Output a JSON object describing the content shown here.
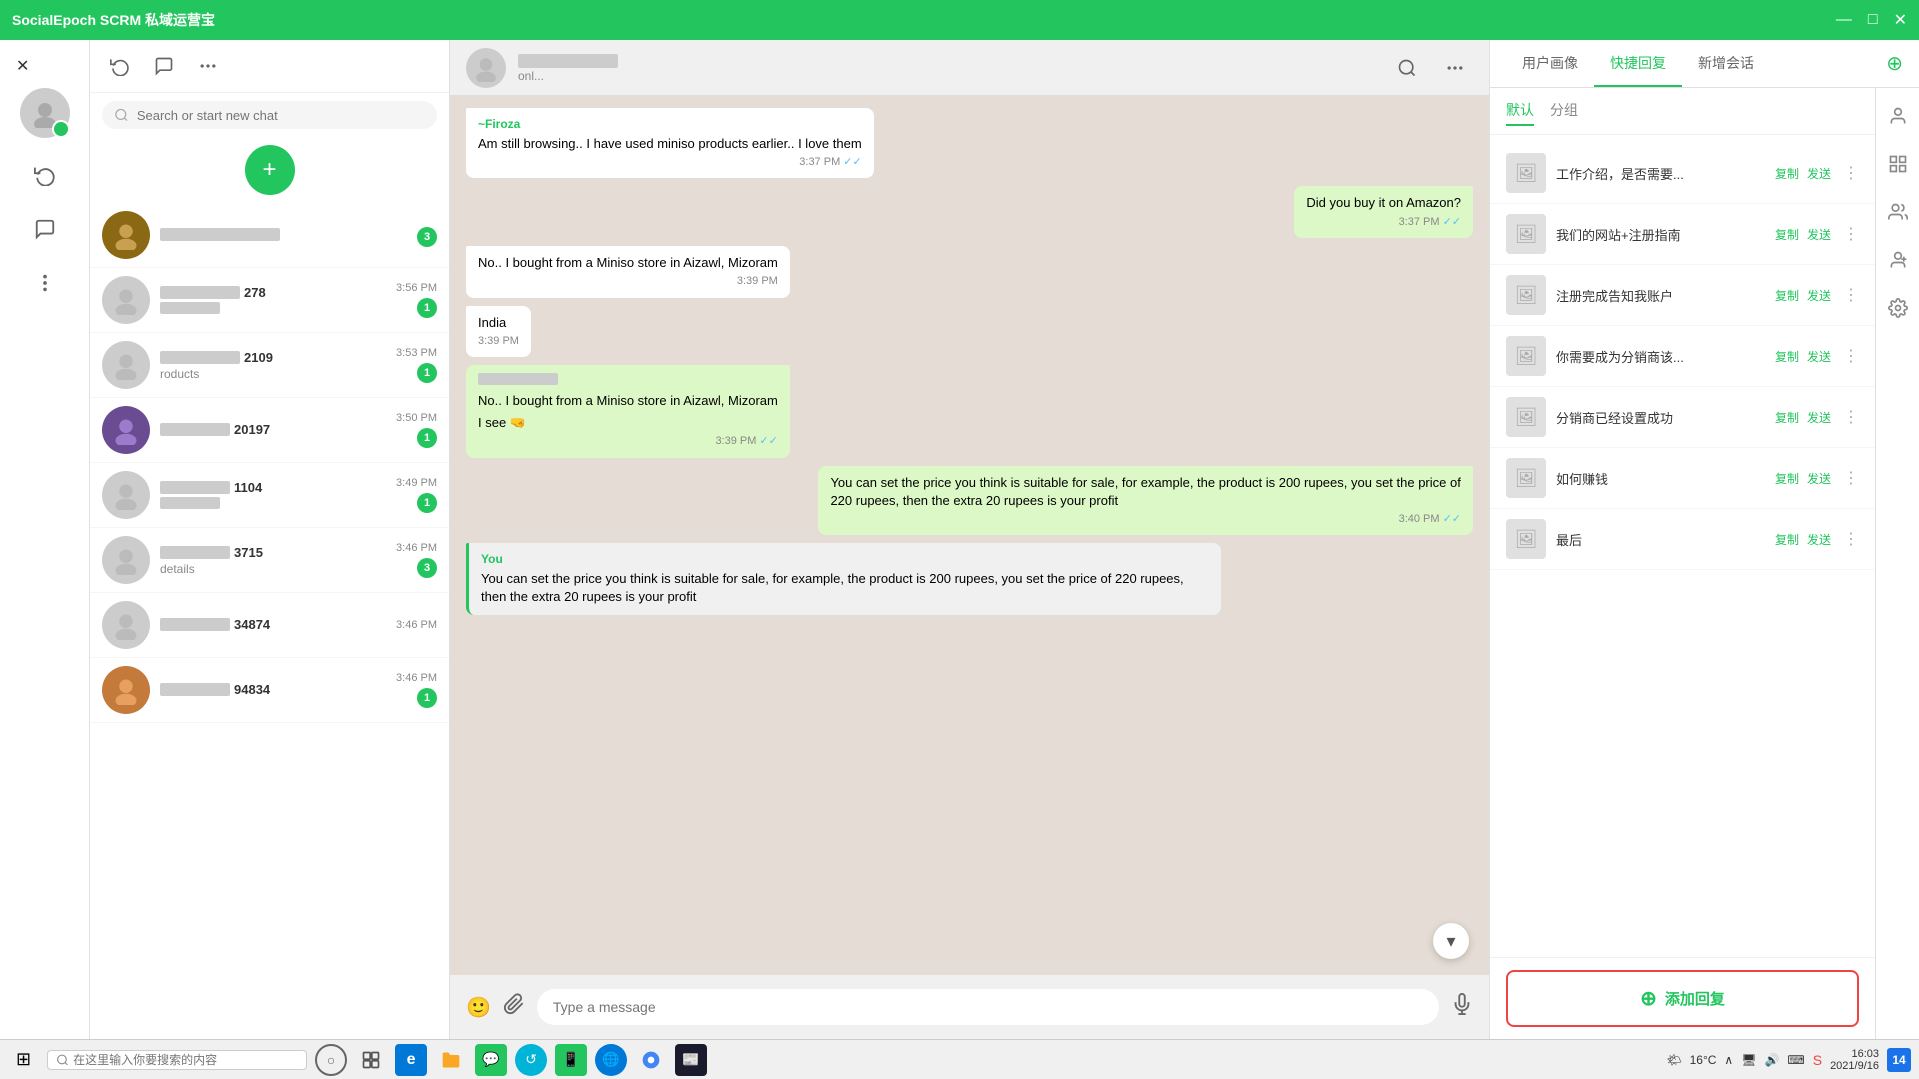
{
  "app": {
    "title": "SocialEpoch SCRM 私域运营宝",
    "window_controls": [
      "—",
      "□",
      "✕"
    ]
  },
  "icon_strip": {
    "close_label": "✕",
    "icons": [
      "sync",
      "chat",
      "more"
    ]
  },
  "search": {
    "placeholder": "Search or start new chat"
  },
  "new_chat_btn": "+",
  "chat_list": [
    {
      "id": 1,
      "name_blurred": true,
      "name_suffix": "",
      "time": "",
      "badge": 0,
      "preview": "",
      "has_photo": true
    },
    {
      "id": 2,
      "name_blurred": true,
      "name_suffix": "278",
      "time": "3:56 PM",
      "badge": 1,
      "preview": ""
    },
    {
      "id": 3,
      "name_blurred": true,
      "name_suffix": "109",
      "time": "3:53 PM",
      "badge": 1,
      "preview": "roducts"
    },
    {
      "id": 4,
      "name_blurred": true,
      "name_suffix": "20197",
      "time": "3:50 PM",
      "badge": 1,
      "preview": "",
      "has_photo": true
    },
    {
      "id": 5,
      "name_blurred": true,
      "name_suffix": "1104",
      "time": "3:49 PM",
      "badge": 1,
      "preview": ""
    },
    {
      "id": 6,
      "name_blurred": true,
      "name_suffix": "3715",
      "time": "3:46 PM",
      "badge": 3,
      "preview": "details"
    },
    {
      "id": 7,
      "name_blurred": true,
      "name_suffix": "34874",
      "time": "3:46 PM",
      "badge": 0,
      "preview": ""
    },
    {
      "id": 8,
      "name_blurred": true,
      "name_suffix": "94834",
      "time": "3:46 PM",
      "badge": 1,
      "preview": "",
      "has_photo": true
    }
  ],
  "chat_header": {
    "contact_name_blurred": true,
    "contact_status": "onl..."
  },
  "messages": [
    {
      "id": 1,
      "type": "received",
      "sender": "~Firoza",
      "text": "Am still browsing.. I have used miniso products earlier.. I love them",
      "time": "3:37 PM",
      "double_check": true
    },
    {
      "id": 2,
      "type": "sent",
      "text": "Did you buy it on Amazon?",
      "time": "3:37 PM",
      "double_check": true
    },
    {
      "id": 3,
      "type": "received",
      "text": "No.. I bought from a Miniso store in Aizawl, Mizoram",
      "time": "3:39 PM"
    },
    {
      "id": 4,
      "type": "received",
      "text": "India",
      "time": "3:39 PM"
    },
    {
      "id": 5,
      "type": "received_green",
      "sender": "blurred",
      "text": "No.. I bought from a Miniso store in Aizawl, Mizoram",
      "sub_text": "I see 🤜",
      "time": "3:39 PM",
      "double_check": true
    },
    {
      "id": 6,
      "type": "sent",
      "text": "You can set the price you think is suitable for sale, for example, the product is 200 rupees, you set the price of 220 rupees, then the extra 20 rupees is your profit",
      "time": "3:40 PM",
      "double_check": true
    },
    {
      "id": 7,
      "type": "you_preview",
      "sender": "You",
      "text": "You can set the price you think is suitable for sale, for example, the product is 200 rupees, you set the price of 220 rupees, then the extra 20 rupees is your profit"
    }
  ],
  "input_placeholder": "Type a message",
  "right_panel": {
    "tabs": [
      "用户画像",
      "快捷回复",
      "新增会话"
    ],
    "active_tab": "快捷回复",
    "subtabs": [
      "默认",
      "分组"
    ],
    "active_subtab": "默认",
    "more_btn_label": "⊕",
    "quick_replies": [
      {
        "id": 1,
        "text": "工作介绍，是否需要...",
        "copy": "复制",
        "send": "发送"
      },
      {
        "id": 2,
        "text": "我们的网站+注册指南",
        "copy": "复制",
        "send": "发送"
      },
      {
        "id": 3,
        "text": "注册完成告知我账户",
        "copy": "复制",
        "send": "发送"
      },
      {
        "id": 4,
        "text": "你需要成为分销商该...",
        "copy": "复制",
        "send": "发送"
      },
      {
        "id": 5,
        "text": "分销商已经设置成功",
        "copy": "复制",
        "send": "发送"
      },
      {
        "id": 6,
        "text": "如何赚钱",
        "copy": "复制",
        "send": "发送"
      },
      {
        "id": 7,
        "text": "最后",
        "copy": "复制",
        "send": "发送"
      }
    ],
    "sidebar_icons": [
      "user-profile",
      "qr-code",
      "contacts",
      "user-add",
      "settings"
    ],
    "add_reply_label": "添加回复"
  },
  "taskbar": {
    "start_icon": "⊞",
    "search_placeholder": "在这里输入你要搜索的内容",
    "weather": "🌤",
    "temperature": "16°C",
    "time": "16:03",
    "date": "2021/9/16",
    "notification_count": "14"
  }
}
